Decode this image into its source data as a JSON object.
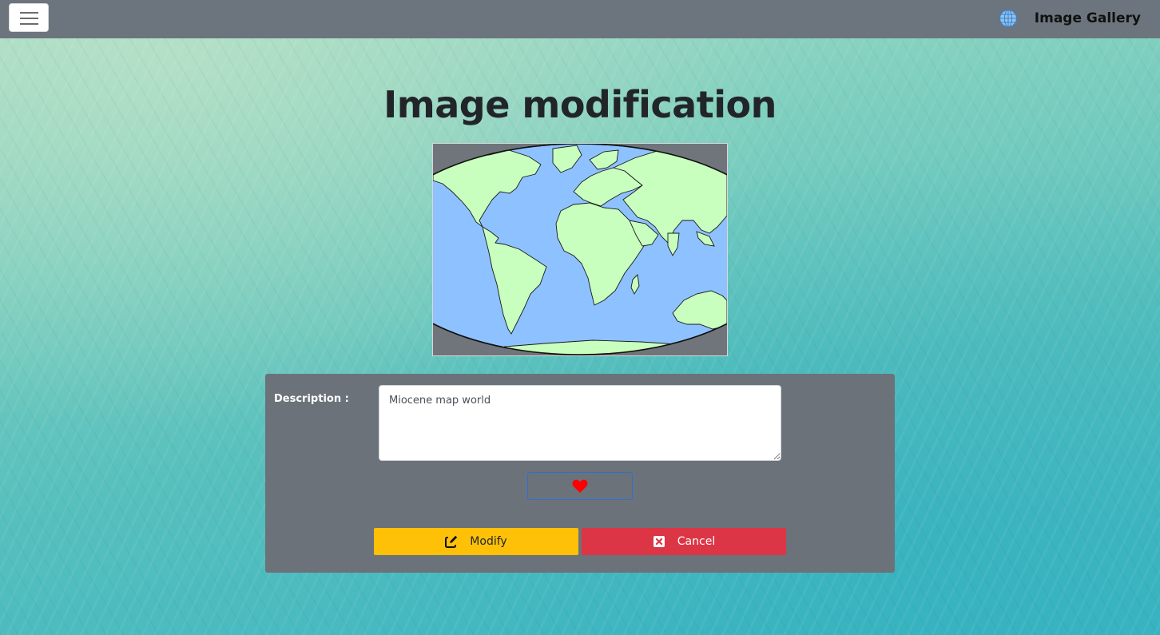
{
  "navbar": {
    "brand_text": "Image Gallery",
    "brand_icon": "globe-icon",
    "menu_icon": "hamburger-menu-icon"
  },
  "page": {
    "title": "Image modification"
  },
  "image": {
    "subject": "world-map",
    "colors": {
      "ocean": "#8ec1ff",
      "land": "#c8ffbe",
      "border": "#1a1a1a",
      "frame": "#6f757a"
    }
  },
  "form": {
    "description_label": "Description :",
    "description_value": "Miocene map world",
    "favorite_icon": "heart-icon",
    "favorite_color": "#ff0000",
    "modify_label": "Modify",
    "modify_icon": "edit-icon",
    "cancel_label": "Cancel",
    "cancel_icon": "close-box-icon"
  },
  "colors": {
    "navbar": "#6c757d",
    "card": "#6c727a",
    "modify_button": "#ffc107",
    "cancel_button": "#dc3545",
    "favorite_border": "#2f6fd0"
  }
}
